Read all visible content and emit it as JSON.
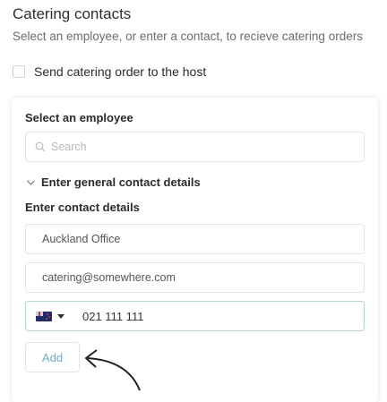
{
  "header": {
    "title": "Catering contacts",
    "subtitle": "Select an employee, or enter a contact, to recieve catering orders"
  },
  "host_option": {
    "label": "Send catering order to the host",
    "checked": false
  },
  "employee": {
    "label": "Select an employee",
    "search_placeholder": "Search"
  },
  "general_contact": {
    "toggle_label": "Enter general contact details",
    "expanded": true
  },
  "contact_details": {
    "label": "Enter contact details",
    "name_value": "Auckland Office",
    "email_value": "catering@somewhere.com",
    "phone_country": "nz-flag-icon",
    "phone_value": "021 111 111",
    "add_label": "Add"
  },
  "colors": {
    "accent": "#6fb0c5",
    "phone_border": "#b4d7bd"
  }
}
